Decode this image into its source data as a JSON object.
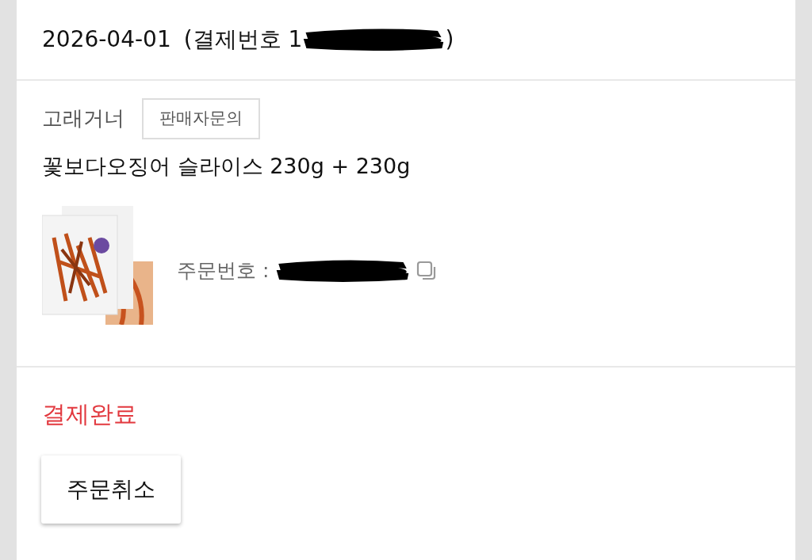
{
  "order_header": {
    "date": "2026-04-01",
    "payment_label": "(결제번호 1",
    "payment_close": ")"
  },
  "seller": {
    "name": "고래거너",
    "contact_button": "판매자문의"
  },
  "product": {
    "title": "꽃보다오징어 슬라이스 230g + 230g",
    "order_number_label": "주문번호 :"
  },
  "status": {
    "text": "결제완료"
  },
  "buttons": [
    "주문취소"
  ]
}
